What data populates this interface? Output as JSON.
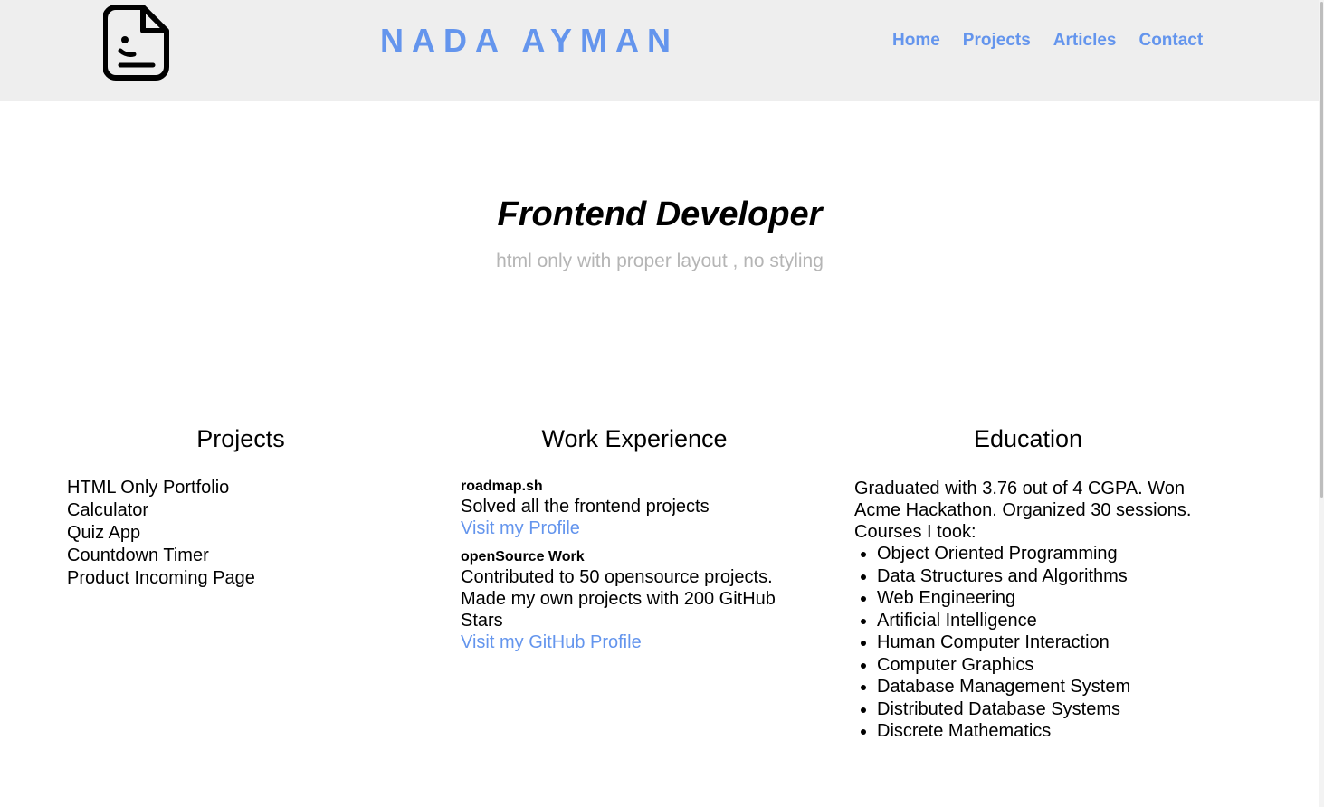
{
  "header": {
    "logo_icon": "document-face-icon",
    "brand": "NADA AYMAN",
    "nav": [
      {
        "label": "Home"
      },
      {
        "label": "Projects"
      },
      {
        "label": "Articles"
      },
      {
        "label": "Contact"
      }
    ]
  },
  "hero": {
    "title": "Frontend Developer",
    "subtitle": "html only with proper layout , no styling"
  },
  "projects": {
    "heading": "Projects",
    "items": [
      "HTML Only Portfolio",
      "Calculator",
      "Quiz App",
      "Countdown Timer",
      "Product Incoming Page"
    ]
  },
  "work": {
    "heading": "Work Experience",
    "jobs": [
      {
        "title": "roadmap.sh",
        "description": "Solved all the frontend projects",
        "link": "Visit my Profile"
      },
      {
        "title": "openSource Work",
        "description": "Contributed to 50 opensource projects. Made my own projects with 200 GitHub Stars",
        "link": "Visit my GitHub Profile"
      }
    ]
  },
  "education": {
    "heading": "Education",
    "text": "Graduated with 3.76 out of 4 CGPA. Won Acme Hackathon. Organized 30 sessions. Courses I took:",
    "courses": [
      "Object Oriented Programming",
      "Data Structures and Algorithms",
      "Web Engineering",
      "Artificial Intelligence",
      "Human Computer Interaction",
      "Computer Graphics",
      "Database Management System",
      "Distributed Database Systems",
      "Discrete Mathematics"
    ]
  },
  "colors": {
    "accent": "#6495ed",
    "header_bg": "#eeeeee",
    "subtitle": "#b5b5b5"
  }
}
